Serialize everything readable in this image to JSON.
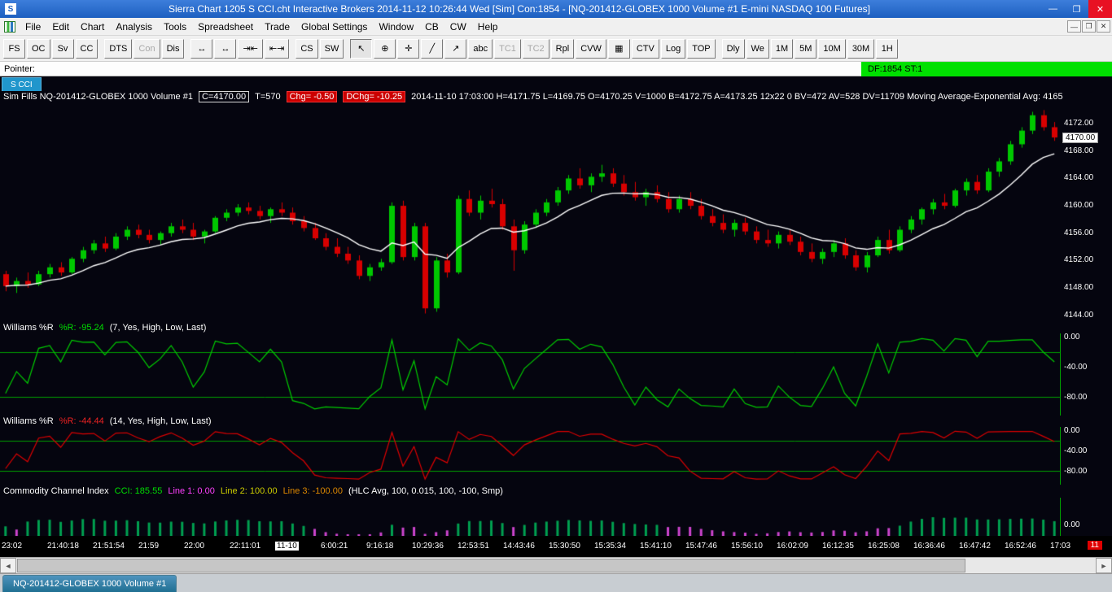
{
  "title_bar": {
    "title": "Sierra Chart 1205 S CCI.cht  Interactive Brokers 2014-11-12  10:26:44 Wed [Sim]  Con:1854 - [NQ-201412-GLOBEX  1000 Volume  #1  E-mini NASDAQ 100 Futures]",
    "app_icon": "S",
    "window_buttons": [
      {
        "name": "minimize",
        "glyph": "—"
      },
      {
        "name": "restore",
        "glyph": "❐"
      },
      {
        "name": "close",
        "glyph": "✕"
      }
    ]
  },
  "menu_bar": {
    "items": [
      "File",
      "Edit",
      "Chart",
      "Analysis",
      "Tools",
      "Spreadsheet",
      "Trade",
      "Global Settings",
      "Window",
      "CB",
      "CW",
      "Help"
    ],
    "mdi_buttons": [
      {
        "name": "mdi-minimize",
        "glyph": "—"
      },
      {
        "name": "mdi-restore",
        "glyph": "❐"
      },
      {
        "name": "mdi-close",
        "glyph": "✕"
      }
    ]
  },
  "toolbar": {
    "buttons": [
      {
        "label": "FS",
        "name": "fs"
      },
      {
        "label": "OC",
        "name": "oc"
      },
      {
        "label": "Sv",
        "name": "sv"
      },
      {
        "label": "CC",
        "name": "cc"
      },
      {
        "sep": true
      },
      {
        "label": "DTS",
        "name": "dts"
      },
      {
        "label": "Con",
        "name": "con",
        "disabled": true
      },
      {
        "label": "Dis",
        "name": "dis"
      },
      {
        "sep": true
      },
      {
        "label": "↔",
        "name": "hscale-expand-icon",
        "icon": true
      },
      {
        "label": "↔",
        "name": "hscale-expand-alt-icon",
        "icon": true
      },
      {
        "label": "⇥⇤",
        "name": "bar-space-compress-icon",
        "icon": true
      },
      {
        "label": "⇤⇥",
        "name": "bar-space-expand-icon",
        "icon": true
      },
      {
        "sep": true
      },
      {
        "label": "CS",
        "name": "cs"
      },
      {
        "label": "SW",
        "name": "sw"
      },
      {
        "sep": true
      },
      {
        "label": "↖",
        "name": "pointer-tool",
        "icon": true,
        "pressed": true
      },
      {
        "label": "⊕",
        "name": "crosshair-tool",
        "icon": true
      },
      {
        "label": "✛",
        "name": "cross-lines-tool",
        "icon": true
      },
      {
        "label": "╱",
        "name": "line-tool",
        "icon": true
      },
      {
        "label": "↗",
        "name": "ray-tool",
        "icon": true
      },
      {
        "label": "abc",
        "name": "text-tool"
      },
      {
        "label": "TC1",
        "name": "tc1",
        "disabled": true
      },
      {
        "label": "TC2",
        "name": "tc2",
        "disabled": true
      },
      {
        "label": "Rpl",
        "name": "rpl"
      },
      {
        "label": "CVW",
        "name": "cvw"
      },
      {
        "label": "▦",
        "name": "trade-window-grid-icon",
        "icon": true
      },
      {
        "label": "CTV",
        "name": "ctv"
      },
      {
        "label": "Log",
        "name": "log"
      },
      {
        "label": "TOP",
        "name": "top"
      },
      {
        "sep": true
      },
      {
        "label": "Dly",
        "name": "dly"
      },
      {
        "label": "We",
        "name": "we"
      },
      {
        "label": "1M",
        "name": "1m"
      },
      {
        "label": "5M",
        "name": "5m"
      },
      {
        "label": "10M",
        "name": "10m"
      },
      {
        "label": "30M",
        "name": "30m"
      },
      {
        "label": "1H",
        "name": "1h"
      }
    ]
  },
  "pointer_bar": {
    "label": "Pointer:",
    "status": "DF:1854  ST:1"
  },
  "chart_tab": {
    "label": "S CCI"
  },
  "panel_headers": {
    "price": [
      {
        "text": "Sim Fills  NQ-201412-GLOBEX  1000 Volume  #1",
        "style": "plain"
      },
      {
        "text": "C=4170.00",
        "style": "boxed"
      },
      {
        "text": "T=570",
        "style": "plain"
      },
      {
        "text": "Chg= -0.50",
        "style": "red"
      },
      {
        "text": "DChg= -10.25",
        "style": "red"
      },
      {
        "text": "2014-11-10 17:03:00  H=4171.75 L=4169.75 O=4170.25 V=1000 B=4172.75 A=4173.25 12x22 0 BV=472 AV=528 DV=11709  Moving Average-Exponential  Avg: 4165",
        "style": "plain"
      }
    ],
    "wr1": [
      {
        "text": "Williams %R",
        "color": "#ffffff"
      },
      {
        "text": "%R: -95.24",
        "color": "#00dd00"
      },
      {
        "text": "(7, Yes, High, Low, Last)",
        "color": "#ffffff"
      }
    ],
    "wr2": [
      {
        "text": "Williams %R",
        "color": "#ffffff"
      },
      {
        "text": "%R: -44.44",
        "color": "#ee2222"
      },
      {
        "text": "(14, Yes, High, Low, Last)",
        "color": "#ffffff"
      }
    ],
    "cci": [
      {
        "text": "Commodity Channel Index",
        "color": "#ffffff"
      },
      {
        "text": "CCI: 185.55",
        "color": "#00dd00"
      },
      {
        "text": "Line 1: 0.00",
        "color": "#ff40ff"
      },
      {
        "text": "Line 2: 100.00",
        "color": "#cccc00"
      },
      {
        "text": "Line 3: -100.00",
        "color": "#dd8800"
      },
      {
        "text": "(HLC Avg, 100, 0.015, 100, -100, Smp)",
        "color": "#ffffff"
      }
    ]
  },
  "scrollbar": {
    "left": "◄",
    "right": "►"
  },
  "bottom_tab": {
    "label": "NQ-201412-GLOBEX  1000 Volume  #1"
  },
  "chart_data": {
    "type": "candlestick",
    "symbol": "NQ-201412-GLOBEX 1000 Volume #1",
    "colors": {
      "up": "#00c800",
      "down": "#d80000",
      "ma": "#ffffff",
      "level": "#00a000",
      "bg": "#05050f"
    },
    "price_range": [
      4143,
      4175
    ],
    "price_axis_labels": [
      "4172.00",
      "4170.00",
      "4168.00",
      "4164.00",
      "4160.00",
      "4156.00",
      "4152.00",
      "4148.00",
      "4144.00"
    ],
    "last_price": "4170.00",
    "ma_period": 10,
    "wr1": {
      "period": 7,
      "color": "#00cc00",
      "levels": [
        -20,
        -80
      ],
      "axis": [
        "0.00",
        "-40.00",
        "-80.00"
      ]
    },
    "wr2": {
      "period": 14,
      "color": "#dd0000",
      "levels": [
        -20,
        -80
      ],
      "axis": [
        "0.00",
        "-40.00",
        "-80.00"
      ]
    },
    "cci": {
      "period": 20,
      "colors": {
        "pos": "#00a050",
        "neg": "#cc44cc"
      },
      "axis": [
        "0.00"
      ]
    },
    "time_labels": [
      "23:02",
      "21:40:18",
      "21:51:54",
      "21:59",
      "22:00",
      "22:11:01",
      "11-10",
      "6:00:21",
      "9:16:18",
      "10:29:36",
      "12:53:51",
      "14:43:46",
      "15:30:50",
      "15:35:34",
      "15:41:10",
      "15:47:46",
      "15:56:10",
      "16:02:09",
      "16:12:35",
      "16:25:08",
      "16:36:46",
      "16:47:42",
      "16:52:46",
      "17:03"
    ],
    "time_highlight": "11-10",
    "corner_badge": "11",
    "candles": [
      [
        4150,
        4150.5,
        4147.5,
        4148.25
      ],
      [
        4148.25,
        4149.5,
        4147.25,
        4149
      ],
      [
        4149,
        4150.25,
        4148,
        4148.5
      ],
      [
        4148.5,
        4150.5,
        4148.25,
        4150
      ],
      [
        4150,
        4151.5,
        4149.5,
        4151
      ],
      [
        4151,
        4151.75,
        4149.75,
        4150.25
      ],
      [
        4150.25,
        4152.5,
        4150,
        4152.25
      ],
      [
        4152.25,
        4154,
        4151.75,
        4153.5
      ],
      [
        4153.5,
        4155,
        4153,
        4154.5
      ],
      [
        4154.5,
        4155.5,
        4153.25,
        4153.75
      ],
      [
        4153.75,
        4156,
        4153.5,
        4155.5
      ],
      [
        4155.5,
        4157,
        4155,
        4156.5
      ],
      [
        4156.5,
        4157.25,
        4155.25,
        4155.75
      ],
      [
        4155.75,
        4156.5,
        4154.5,
        4155
      ],
      [
        4155,
        4156.25,
        4154.25,
        4156
      ],
      [
        4156,
        4157.5,
        4155.5,
        4157
      ],
      [
        4157,
        4158,
        4156,
        4156.5
      ],
      [
        4156.5,
        4157.5,
        4155,
        4155.5
      ],
      [
        4155.5,
        4156.5,
        4154.5,
        4156.25
      ],
      [
        4156.25,
        4158.5,
        4156,
        4158.25
      ],
      [
        4158.25,
        4159.5,
        4157.75,
        4159
      ],
      [
        4159,
        4160.25,
        4158.5,
        4159.75
      ],
      [
        4159.75,
        4160.5,
        4158.75,
        4159.25
      ],
      [
        4159.25,
        4160,
        4158,
        4158.5
      ],
      [
        4158.5,
        4159.75,
        4157.5,
        4159.5
      ],
      [
        4159.5,
        4160.5,
        4158.5,
        4159
      ],
      [
        4159,
        4159.75,
        4157.25,
        4157.75
      ],
      [
        4157.75,
        4158.5,
        4156.25,
        4156.75
      ],
      [
        4156.75,
        4157.5,
        4155,
        4155.25
      ],
      [
        4155.25,
        4156,
        4153.5,
        4154
      ],
      [
        4154,
        4155.25,
        4152.5,
        4153
      ],
      [
        4153,
        4154,
        4151.5,
        4152
      ],
      [
        4152,
        4152.75,
        4149.25,
        4149.75
      ],
      [
        4149.75,
        4151.5,
        4149,
        4151
      ],
      [
        4151,
        4152.25,
        4150.5,
        4151.75
      ],
      [
        4151.75,
        4160.5,
        4151.5,
        4160
      ],
      [
        4160,
        4160.75,
        4152,
        4152.5
      ],
      [
        4152.5,
        4157.5,
        4152,
        4157
      ],
      [
        4157,
        4157.5,
        4144.25,
        4145
      ],
      [
        4145,
        4152.5,
        4144.5,
        4152
      ],
      [
        4152,
        4153,
        4149.5,
        4150.25
      ],
      [
        4150.25,
        4161.5,
        4150,
        4161
      ],
      [
        4161,
        4162.25,
        4158.5,
        4159
      ],
      [
        4159,
        4161.5,
        4158,
        4160.75
      ],
      [
        4160.75,
        4162.5,
        4159.75,
        4160.25
      ],
      [
        4160.25,
        4161,
        4156.5,
        4157
      ],
      [
        4157,
        4158,
        4150.5,
        4153.5
      ],
      [
        4153.5,
        4157.75,
        4153,
        4157.25
      ],
      [
        4157.25,
        4159.5,
        4156.75,
        4159
      ],
      [
        4159,
        4161,
        4158.5,
        4160.5
      ],
      [
        4160.5,
        4162.75,
        4160,
        4162.25
      ],
      [
        4162.25,
        4164.5,
        4161.75,
        4164
      ],
      [
        4164,
        4165.5,
        4162.5,
        4163
      ],
      [
        4163,
        4164.75,
        4162,
        4164.25
      ],
      [
        4164.25,
        4166,
        4163.5,
        4164.75
      ],
      [
        4164.75,
        4165.5,
        4162.75,
        4163.25
      ],
      [
        4163.25,
        4164.5,
        4161.5,
        4162
      ],
      [
        4162,
        4163.5,
        4160.75,
        4161.25
      ],
      [
        4161.25,
        4162.5,
        4160,
        4162
      ],
      [
        4162,
        4163,
        4160.5,
        4161
      ],
      [
        4161,
        4162,
        4159,
        4159.5
      ],
      [
        4159.5,
        4161.5,
        4159,
        4161
      ],
      [
        4161,
        4162,
        4159.5,
        4160
      ],
      [
        4160,
        4161,
        4158,
        4158.5
      ],
      [
        4158.5,
        4159.5,
        4157,
        4157.5
      ],
      [
        4157.5,
        4158.75,
        4156,
        4156.5
      ],
      [
        4156.5,
        4158,
        4155.5,
        4157.5
      ],
      [
        4157.5,
        4158.25,
        4155.75,
        4156.25
      ],
      [
        4156.25,
        4157,
        4154.5,
        4155
      ],
      [
        4155,
        4156.5,
        4154,
        4154.5
      ],
      [
        4154.5,
        4156.25,
        4153.75,
        4155.75
      ],
      [
        4155.75,
        4156.5,
        4154.25,
        4154.75
      ],
      [
        4154.75,
        4155.5,
        4152.75,
        4153.25
      ],
      [
        4153.25,
        4154.5,
        4151.75,
        4152.25
      ],
      [
        4152.25,
        4153.75,
        4151.5,
        4153.25
      ],
      [
        4153.25,
        4155,
        4152.5,
        4154.5
      ],
      [
        4154.5,
        4155.25,
        4152.25,
        4152.75
      ],
      [
        4152.75,
        4153.5,
        4150.5,
        4151
      ],
      [
        4151,
        4153.25,
        4150.25,
        4152.75
      ],
      [
        4152.75,
        4155.5,
        4152.5,
        4155
      ],
      [
        4155,
        4156.5,
        4153,
        4153.5
      ],
      [
        4153.5,
        4157,
        4153.25,
        4156.5
      ],
      [
        4156.5,
        4158.5,
        4156,
        4158
      ],
      [
        4158,
        4159.75,
        4157.25,
        4159.5
      ],
      [
        4159.5,
        4161,
        4158.75,
        4160.5
      ],
      [
        4160.5,
        4161.75,
        4159.5,
        4160
      ],
      [
        4160,
        4162.5,
        4159.75,
        4162.25
      ],
      [
        4162.25,
        4164,
        4161.5,
        4163.5
      ],
      [
        4163.5,
        4164.5,
        4161.75,
        4162.25
      ],
      [
        4162.25,
        4165.5,
        4162,
        4165
      ],
      [
        4165,
        4167,
        4164.25,
        4166.5
      ],
      [
        4166.5,
        4169.5,
        4166,
        4169
      ],
      [
        4169,
        4171.5,
        4168.5,
        4171
      ],
      [
        4171,
        4173.75,
        4170.5,
        4173.25
      ],
      [
        4173.25,
        4174,
        4171,
        4171.5
      ],
      [
        4171.5,
        4172.25,
        4169.5,
        4170
      ]
    ]
  }
}
